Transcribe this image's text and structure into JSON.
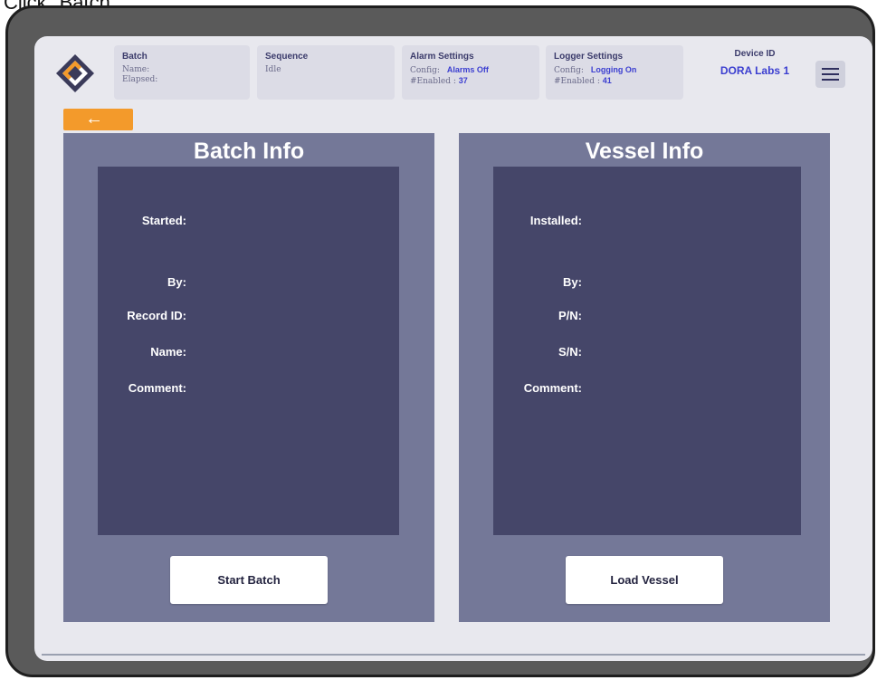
{
  "caption": "Click \"Batch.\"",
  "header": {
    "batch": {
      "title": "Batch",
      "name_label": "Name:",
      "elapsed_label": "Elapsed:"
    },
    "sequence": {
      "title": "Sequence",
      "status": "Idle"
    },
    "alarm": {
      "title": "Alarm Settings",
      "config_label": "Config:",
      "config_value": "Alarms Off",
      "enabled_label": "#Enabled : ",
      "enabled_value": "37"
    },
    "logger": {
      "title": "Logger Settings",
      "config_label": "Config:",
      "config_value": "Logging On",
      "enabled_label": "#Enabled : ",
      "enabled_value": "41"
    },
    "device": {
      "title": "Device ID",
      "value": "DORA Labs 1"
    },
    "back_icon": "←"
  },
  "batch_panel": {
    "title": "Batch Info",
    "fields": {
      "started": "Started:",
      "by": "By:",
      "record_id": "Record ID:",
      "name": "Name:",
      "comment": "Comment:"
    },
    "button": "Start Batch"
  },
  "vessel_panel": {
    "title": "Vessel Info",
    "fields": {
      "installed": "Installed:",
      "by": "By:",
      "pn": "P/N:",
      "sn": "S/N:",
      "comment": "Comment:"
    },
    "button": "Load Vessel"
  },
  "colors": {
    "accent_orange": "#f39a2b",
    "panel": "#747898",
    "panel_inner": "#454669",
    "highlight_blue": "#3b3ed0"
  }
}
